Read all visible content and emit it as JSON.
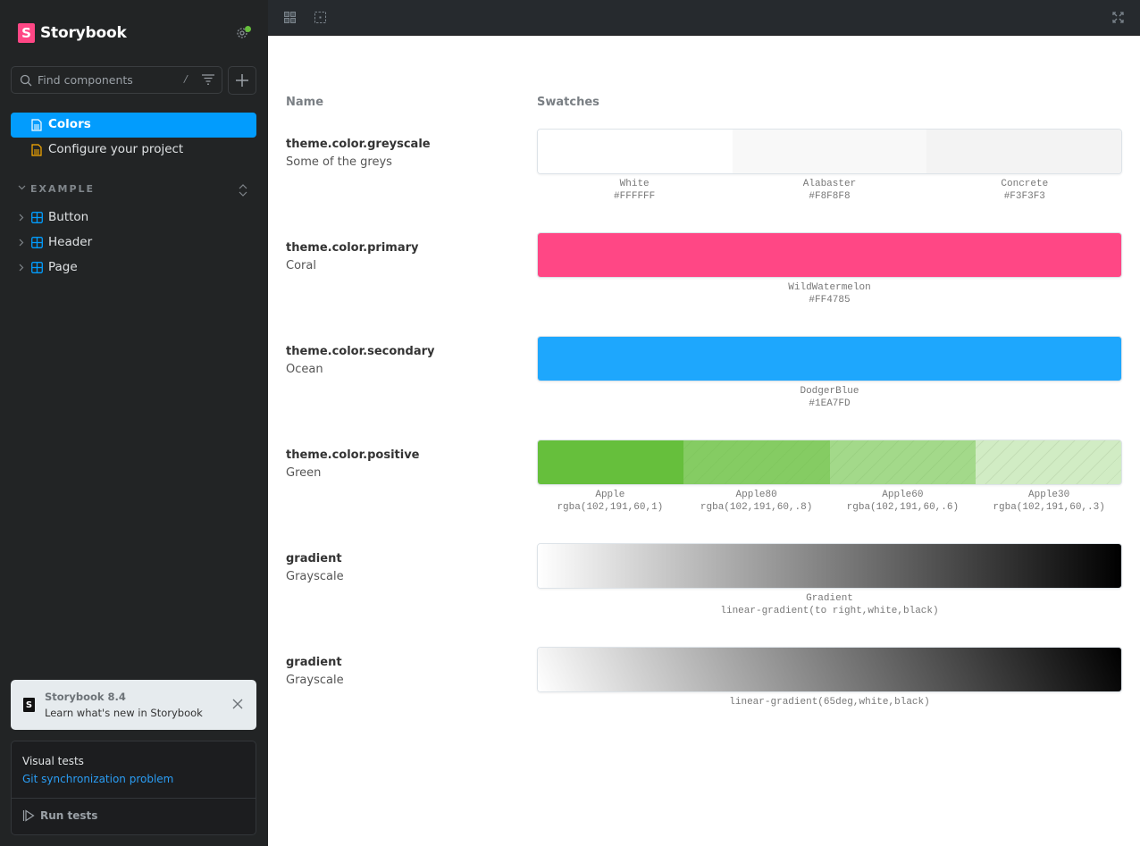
{
  "app": {
    "name": "Storybook"
  },
  "sidebar": {
    "search": {
      "placeholder": "Find components",
      "shortcut": "/"
    },
    "docs": [
      {
        "label": "Colors",
        "active": true,
        "icon": "document-icon"
      },
      {
        "label": "Configure your project",
        "active": false,
        "icon": "document-icon"
      }
    ],
    "group": {
      "label": "EXAMPLE"
    },
    "tree": [
      {
        "label": "Button",
        "icon": "component-icon"
      },
      {
        "label": "Header",
        "icon": "component-icon"
      },
      {
        "label": "Page",
        "icon": "component-icon"
      }
    ],
    "notice": {
      "title": "Storybook 8.4",
      "subtitle": "Learn what's new in Storybook"
    },
    "visual_tests": {
      "title": "Visual tests",
      "link": "Git synchronization problem",
      "run_label": "Run tests"
    }
  },
  "toolbar": {
    "icons": [
      "grid-icon",
      "outline-icon",
      "fullscreen-icon"
    ]
  },
  "main": {
    "columns": {
      "name": "Name",
      "swatches": "Swatches"
    },
    "rows": [
      {
        "name": "theme.color.greyscale",
        "desc": "Some of the greys",
        "swatches": [
          {
            "name": "White",
            "value": "#FFFFFF",
            "color": "#FFFFFF"
          },
          {
            "name": "Alabaster",
            "value": "#F8F8F8",
            "color": "#F8F8F8"
          },
          {
            "name": "Concrete",
            "value": "#F3F3F3",
            "color": "#F3F3F3"
          }
        ]
      },
      {
        "name": "theme.color.primary",
        "desc": "Coral",
        "swatches": [
          {
            "name": "WildWatermelon",
            "value": "#FF4785",
            "color": "#FF4785"
          }
        ]
      },
      {
        "name": "theme.color.secondary",
        "desc": "Ocean",
        "swatches": [
          {
            "name": "DodgerBlue",
            "value": "#1EA7FD",
            "color": "#1EA7FD"
          }
        ]
      },
      {
        "name": "theme.color.positive",
        "desc": "Green",
        "swatches": [
          {
            "name": "Apple",
            "value": "rgba(102,191,60,1)",
            "color": "rgba(102,191,60,1)"
          },
          {
            "name": "Apple80",
            "value": "rgba(102,191,60,.8)",
            "color": "rgba(102,191,60,.8)"
          },
          {
            "name": "Apple60",
            "value": "rgba(102,191,60,.6)",
            "color": "rgba(102,191,60,.6)"
          },
          {
            "name": "Apple30",
            "value": "rgba(102,191,60,.3)",
            "color": "rgba(102,191,60,.3)"
          }
        ]
      },
      {
        "name": "gradient",
        "desc": "Grayscale",
        "swatches": [
          {
            "name": "Gradient",
            "value": "linear-gradient(to right,white,black)",
            "color": "linear-gradient(to right,white,black)"
          }
        ]
      },
      {
        "name": "gradient",
        "desc": "Grayscale",
        "swatches": [
          {
            "name": "",
            "value": "linear-gradient(65deg,white,black)",
            "color": "linear-gradient(65deg,white,black)"
          }
        ]
      }
    ]
  },
  "colors": {
    "accent": "#029CFD",
    "brand": "#FF4785",
    "status_ok": "#66BF3C"
  }
}
